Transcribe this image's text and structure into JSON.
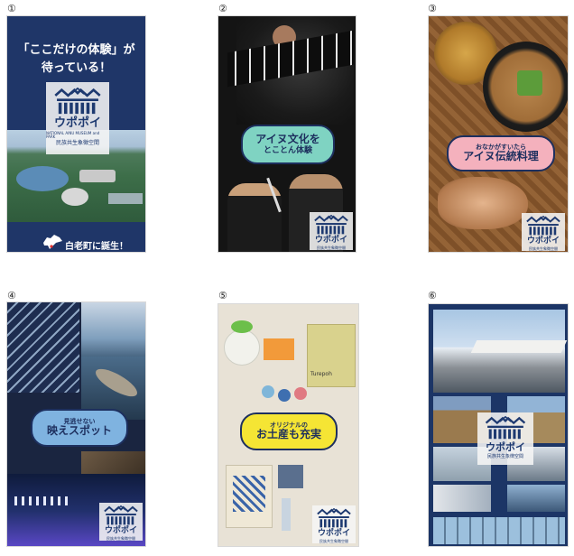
{
  "posters": [
    {
      "number": "①",
      "headline": "「ここだけの体験」が",
      "headline2": "待っている！",
      "logo_title": "ウポポイ",
      "logo_en": "NATIONAL AINU MUSEUM and PARK",
      "logo_jp": "民族共生象徴空間",
      "footer": "白老町に誕生！"
    },
    {
      "number": "②",
      "banner_main": "アイヌ文化を",
      "banner_sub": "とことん体験",
      "logo_title": "ウポポイ",
      "logo_jp": "民族共生象徴空間"
    },
    {
      "number": "③",
      "banner_small": "おなかがすいたら",
      "banner_main": "アイヌ伝統料理",
      "logo_title": "ウポポイ",
      "logo_jp": "民族共生象徴空間"
    },
    {
      "number": "④",
      "banner_small": "見逃せない",
      "banner_main": "映えスポット",
      "logo_title": "ウポポイ",
      "logo_jp": "民族共生象徴空間"
    },
    {
      "number": "⑤",
      "banner_small": "オリジナルの",
      "banner_main": "お土産も充実",
      "product_text": "Turepoh",
      "logo_title": "ウポポイ",
      "logo_jp": "民族共生象徴空間"
    },
    {
      "number": "⑥",
      "logo_title": "ウポポイ",
      "logo_jp": "民族共生象徴空間"
    }
  ],
  "colors": {
    "navy": "#1d3970",
    "banner_teal": "#7fd3c2",
    "banner_pink": "#f4b1bd",
    "banner_blue": "#7fb3e0",
    "banner_yellow": "#f5e534"
  },
  "icons": [
    "hokkaido-map-icon",
    "upopoy-logo-icon"
  ]
}
